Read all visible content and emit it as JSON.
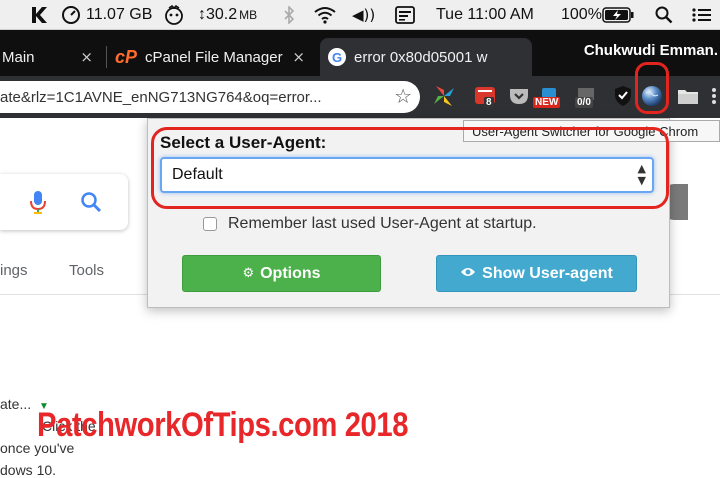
{
  "menubar": {
    "app_letter": "K",
    "disk_free": "11.07 GB",
    "transfer_speed": "↕30.2",
    "transfer_unit": "MB",
    "volume_glyph": "◀))",
    "clock": "Tue 11:00 AM",
    "battery_percent": "100%",
    "icons": [
      "kollision-icon",
      "speed-gauge-icon",
      "avatar-mouse-icon",
      "bluetooth-icon",
      "wifi-icon",
      "volume-icon",
      "calendar-icon",
      "battery-icon",
      "spotlight-search-icon",
      "notification-menu-icon"
    ]
  },
  "tabs": [
    {
      "label": "Main",
      "favicon": null
    },
    {
      "label": "cPanel File Manager",
      "favicon": "cpanel-icon"
    },
    {
      "label": "error 0x80d05001 w",
      "favicon": "google-icon"
    }
  ],
  "tab_close_glyph": "×",
  "profile_name": "Chukwudi Emman.",
  "omnibox": {
    "url_text": "ate&rlz=1C1AVNE_enNG713NG764&oq=error...",
    "star_glyph": "☆"
  },
  "extensions": [
    {
      "name": "pinwheel-extension-icon",
      "badge": ""
    },
    {
      "name": "pocket-red-extension-icon",
      "badge": "8",
      "badge_color": "#cc2b2b"
    },
    {
      "name": "pocket-extension-icon",
      "badge": ""
    },
    {
      "name": "shopping-extension-icon",
      "badge": "NEW",
      "badge_color": "#d9261c"
    },
    {
      "name": "counter-extension-icon",
      "badge": "0/0",
      "badge_color": "#444444"
    },
    {
      "name": "shield-extension-icon",
      "badge": ""
    },
    {
      "name": "user-agent-switcher-icon",
      "badge": ""
    },
    {
      "name": "folder-extension-icon",
      "badge": ""
    }
  ],
  "tooltip": "User-Agent Switcher for Google Chrom",
  "popup": {
    "title": "Select a User-Agent:",
    "selected_user_agent": "Default",
    "remember_label": "Remember last used User-Agent at startup.",
    "remember_checked": false,
    "options_label": "Options",
    "show_label": "Show User-agent",
    "options_color": "#4db14b",
    "show_color": "#44a9cf"
  },
  "google_page": {
    "nav_items": [
      "ings",
      "Tools"
    ],
    "result_fragments": [
      "ate...",
      "Click the",
      "once you've",
      "dows 10."
    ]
  },
  "watermark": "PatchworkOfTips.com 2018",
  "accent_colors": {
    "annotation_red": "#e32520",
    "select_focus_blue": "#6aa7f2"
  }
}
